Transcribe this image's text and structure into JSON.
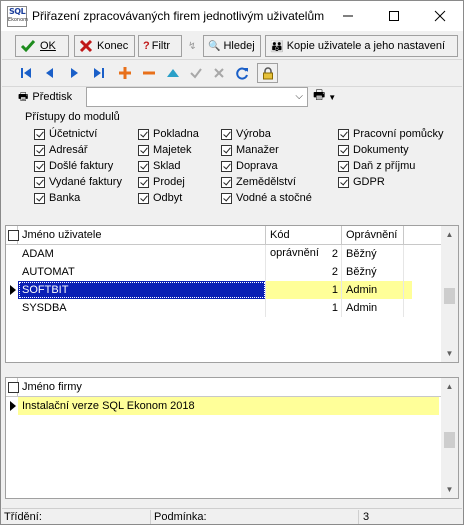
{
  "window": {
    "title": "Přiřazení zpracovávaných firem jednotlivým uživatelům",
    "icon_text_top": "SQL",
    "icon_text_bottom": "Ekonom"
  },
  "toolbar": {
    "ok_label": "OK",
    "konec_label": "Konec",
    "filtr_label": "Filtr",
    "hledej_label": "Hledej",
    "kopie_label": "Kopie uživatele a jeho nastavení"
  },
  "filter_bar": {
    "predtisk_label": "Předtisk",
    "combo_value": ""
  },
  "modules": {
    "legend": "Přístupy do modulů",
    "items": [
      "Účetnictví",
      "Adresář",
      "Došlé faktury",
      "Vydané faktury",
      "Banka",
      "Pokladna",
      "Majetek",
      "Sklad",
      "Prodej",
      "Odbyt",
      "Výroba",
      "Manažer",
      "Doprava",
      "Zemědělství",
      "Vodné a stočné",
      "Pracovní pomůcky",
      "Dokumenty",
      "Daň z příjmu",
      "GDPR"
    ]
  },
  "users_grid": {
    "columns": [
      "Jméno uživatele",
      "Kód oprávnění",
      "Oprávnění"
    ],
    "rows": [
      {
        "name": "ADAM",
        "code": "2",
        "perm": "Běžný"
      },
      {
        "name": "AUTOMAT",
        "code": "2",
        "perm": "Běžný"
      },
      {
        "name": "SOFTBIT",
        "code": "1",
        "perm": "Admin"
      },
      {
        "name": "SYSDBA",
        "code": "1",
        "perm": "Admin"
      }
    ],
    "selected_index": 2
  },
  "firms_grid": {
    "columns": [
      "Jméno firmy"
    ],
    "rows": [
      {
        "name": "Instalační verze SQL Ekonom 2018"
      }
    ]
  },
  "status": {
    "trideni_label": "Třídění:",
    "podminka_label": "Podmínka:",
    "count": "3"
  },
  "colors": {
    "selection": "#0a1fb4",
    "row_highlight": "#ffff99",
    "check_green": "#1e8c1e",
    "cross_red": "#c01818"
  }
}
